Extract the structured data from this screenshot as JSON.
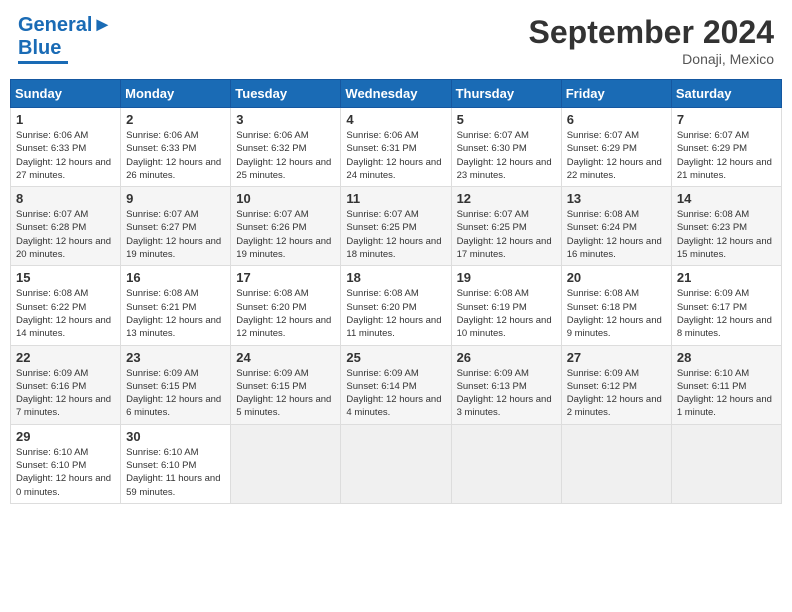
{
  "header": {
    "logo_line1": "General",
    "logo_line2": "Blue",
    "main_title": "September 2024",
    "subtitle": "Donaji, Mexico"
  },
  "calendar": {
    "days_of_week": [
      "Sunday",
      "Monday",
      "Tuesday",
      "Wednesday",
      "Thursday",
      "Friday",
      "Saturday"
    ],
    "weeks": [
      [
        {
          "day": "",
          "empty": true
        },
        {
          "day": "",
          "empty": true
        },
        {
          "day": "",
          "empty": true
        },
        {
          "day": "",
          "empty": true
        },
        {
          "day": "",
          "empty": true
        },
        {
          "day": "",
          "empty": true
        },
        {
          "day": "",
          "empty": true
        }
      ],
      [
        {
          "day": "1",
          "sunrise": "6:06 AM",
          "sunset": "6:33 PM",
          "daylight": "12 hours and 27 minutes."
        },
        {
          "day": "2",
          "sunrise": "6:06 AM",
          "sunset": "6:33 PM",
          "daylight": "12 hours and 26 minutes."
        },
        {
          "day": "3",
          "sunrise": "6:06 AM",
          "sunset": "6:32 PM",
          "daylight": "12 hours and 25 minutes."
        },
        {
          "day": "4",
          "sunrise": "6:06 AM",
          "sunset": "6:31 PM",
          "daylight": "12 hours and 24 minutes."
        },
        {
          "day": "5",
          "sunrise": "6:07 AM",
          "sunset": "6:30 PM",
          "daylight": "12 hours and 23 minutes."
        },
        {
          "day": "6",
          "sunrise": "6:07 AM",
          "sunset": "6:29 PM",
          "daylight": "12 hours and 22 minutes."
        },
        {
          "day": "7",
          "sunrise": "6:07 AM",
          "sunset": "6:29 PM",
          "daylight": "12 hours and 21 minutes."
        }
      ],
      [
        {
          "day": "8",
          "sunrise": "6:07 AM",
          "sunset": "6:28 PM",
          "daylight": "12 hours and 20 minutes."
        },
        {
          "day": "9",
          "sunrise": "6:07 AM",
          "sunset": "6:27 PM",
          "daylight": "12 hours and 19 minutes."
        },
        {
          "day": "10",
          "sunrise": "6:07 AM",
          "sunset": "6:26 PM",
          "daylight": "12 hours and 19 minutes."
        },
        {
          "day": "11",
          "sunrise": "6:07 AM",
          "sunset": "6:25 PM",
          "daylight": "12 hours and 18 minutes."
        },
        {
          "day": "12",
          "sunrise": "6:07 AM",
          "sunset": "6:25 PM",
          "daylight": "12 hours and 17 minutes."
        },
        {
          "day": "13",
          "sunrise": "6:08 AM",
          "sunset": "6:24 PM",
          "daylight": "12 hours and 16 minutes."
        },
        {
          "day": "14",
          "sunrise": "6:08 AM",
          "sunset": "6:23 PM",
          "daylight": "12 hours and 15 minutes."
        }
      ],
      [
        {
          "day": "15",
          "sunrise": "6:08 AM",
          "sunset": "6:22 PM",
          "daylight": "12 hours and 14 minutes."
        },
        {
          "day": "16",
          "sunrise": "6:08 AM",
          "sunset": "6:21 PM",
          "daylight": "12 hours and 13 minutes."
        },
        {
          "day": "17",
          "sunrise": "6:08 AM",
          "sunset": "6:20 PM",
          "daylight": "12 hours and 12 minutes."
        },
        {
          "day": "18",
          "sunrise": "6:08 AM",
          "sunset": "6:20 PM",
          "daylight": "12 hours and 11 minutes."
        },
        {
          "day": "19",
          "sunrise": "6:08 AM",
          "sunset": "6:19 PM",
          "daylight": "12 hours and 10 minutes."
        },
        {
          "day": "20",
          "sunrise": "6:08 AM",
          "sunset": "6:18 PM",
          "daylight": "12 hours and 9 minutes."
        },
        {
          "day": "21",
          "sunrise": "6:09 AM",
          "sunset": "6:17 PM",
          "daylight": "12 hours and 8 minutes."
        }
      ],
      [
        {
          "day": "22",
          "sunrise": "6:09 AM",
          "sunset": "6:16 PM",
          "daylight": "12 hours and 7 minutes."
        },
        {
          "day": "23",
          "sunrise": "6:09 AM",
          "sunset": "6:15 PM",
          "daylight": "12 hours and 6 minutes."
        },
        {
          "day": "24",
          "sunrise": "6:09 AM",
          "sunset": "6:15 PM",
          "daylight": "12 hours and 5 minutes."
        },
        {
          "day": "25",
          "sunrise": "6:09 AM",
          "sunset": "6:14 PM",
          "daylight": "12 hours and 4 minutes."
        },
        {
          "day": "26",
          "sunrise": "6:09 AM",
          "sunset": "6:13 PM",
          "daylight": "12 hours and 3 minutes."
        },
        {
          "day": "27",
          "sunrise": "6:09 AM",
          "sunset": "6:12 PM",
          "daylight": "12 hours and 2 minutes."
        },
        {
          "day": "28",
          "sunrise": "6:10 AM",
          "sunset": "6:11 PM",
          "daylight": "12 hours and 1 minute."
        }
      ],
      [
        {
          "day": "29",
          "sunrise": "6:10 AM",
          "sunset": "6:10 PM",
          "daylight": "12 hours and 0 minutes."
        },
        {
          "day": "30",
          "sunrise": "6:10 AM",
          "sunset": "6:10 PM",
          "daylight": "11 hours and 59 minutes."
        },
        {
          "day": "",
          "empty": true
        },
        {
          "day": "",
          "empty": true
        },
        {
          "day": "",
          "empty": true
        },
        {
          "day": "",
          "empty": true
        },
        {
          "day": "",
          "empty": true
        }
      ]
    ]
  }
}
